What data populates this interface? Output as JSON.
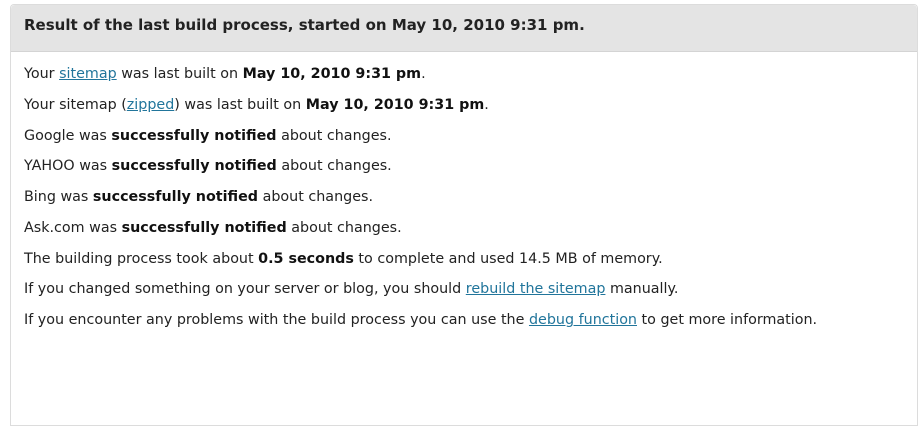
{
  "header": {
    "title": "Result of the last build process, started on May 10, 2010 9:31 pm."
  },
  "lines": {
    "sitemap": {
      "pre": "Your ",
      "link": "sitemap",
      "mid": " was last built on ",
      "date": "May 10, 2010 9:31 pm",
      "post": "."
    },
    "zipped": {
      "pre": "Your sitemap (",
      "link": "zipped",
      "mid": ") was last built on ",
      "date": "May 10, 2010 9:31 pm",
      "post": "."
    },
    "google": {
      "pre": "Google was ",
      "bold": "successfully notified",
      "post": " about changes."
    },
    "yahoo": {
      "pre": "YAHOO was ",
      "bold": "successfully notified",
      "post": " about changes."
    },
    "bing": {
      "pre": "Bing was ",
      "bold": "successfully notified",
      "post": " about changes."
    },
    "ask": {
      "pre": "Ask.com was ",
      "bold": "successfully notified",
      "post": " about changes."
    },
    "duration": {
      "pre": "The building process took about ",
      "bold": "0.5 seconds",
      "post": " to complete and used 14.5 MB of memory."
    },
    "rebuild": {
      "pre": "If you changed something on your server or blog, you should ",
      "link": "rebuild the sitemap",
      "post": " manually."
    },
    "debug": {
      "pre": "If you encounter any problems with the build process you can use the ",
      "link": "debug function",
      "post": " to get more information."
    }
  },
  "colors": {
    "link": "#21759b",
    "header_bg": "#e4e4e4",
    "text": "#222222"
  }
}
